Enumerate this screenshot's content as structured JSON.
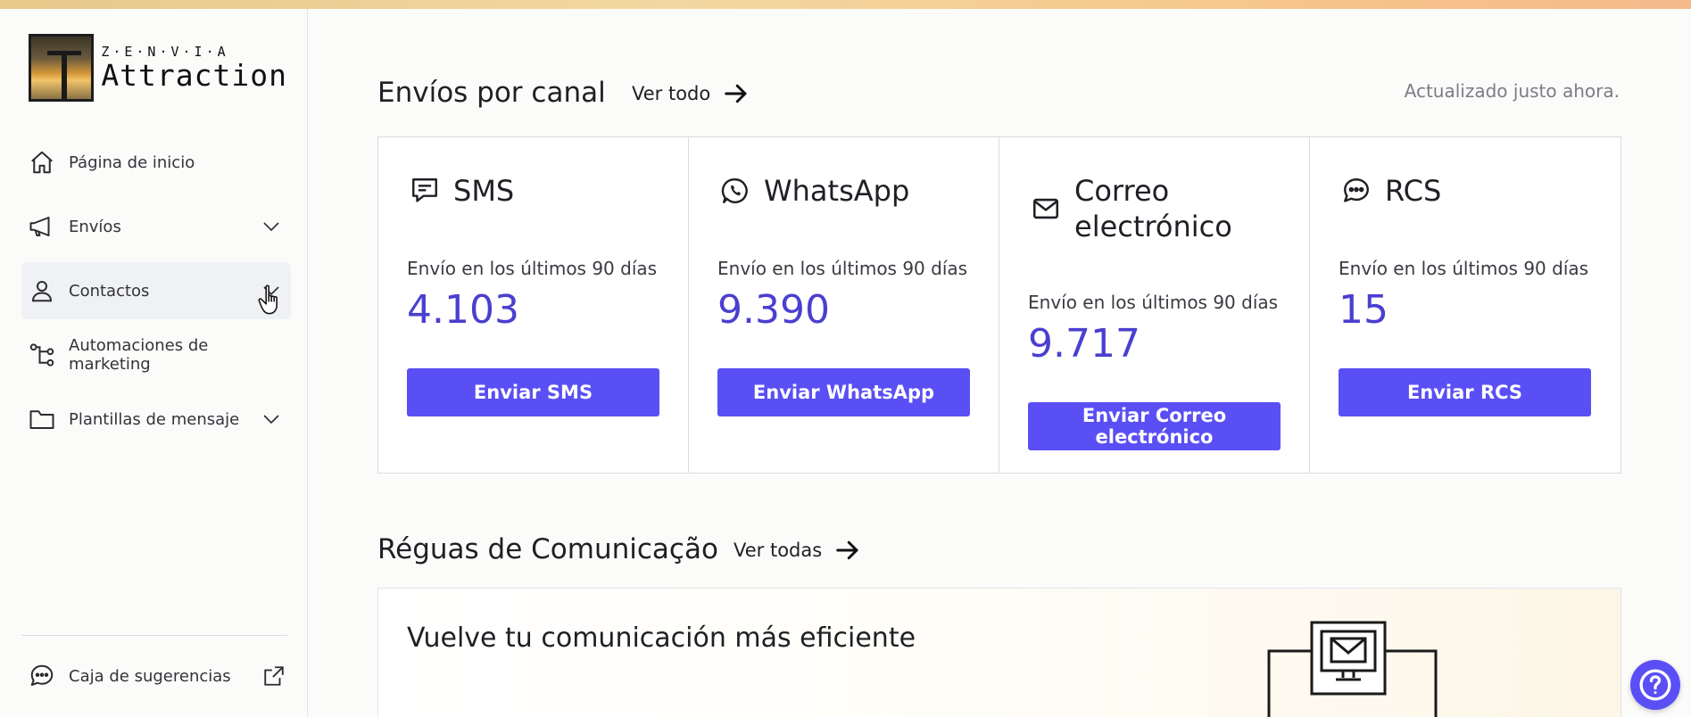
{
  "brand": {
    "company": "Z·E·N·V·I·A",
    "product": "Attraction"
  },
  "sidebar": {
    "items": [
      {
        "label": "Página de inicio",
        "icon": "home-icon"
      },
      {
        "label": "Envíos",
        "icon": "megaphone-icon",
        "expandable": true
      },
      {
        "label": "Contactos",
        "icon": "user-icon",
        "expandable": true,
        "active": true
      },
      {
        "label": "Automaciones de marketing",
        "icon": "flow-icon"
      },
      {
        "label": "Plantillas de mensaje",
        "icon": "folder-icon",
        "expandable": true
      }
    ],
    "feedback": {
      "label": "Caja de sugerencias",
      "icon": "chat-icon"
    }
  },
  "channels": {
    "title": "Envíos por canal",
    "see_all": "Ver todo",
    "updated": "Actualizado justo ahora.",
    "cards": [
      {
        "title": "SMS",
        "subtitle": "Envío en los últimos 90 días",
        "value": "4.103",
        "button": "Enviar SMS",
        "icon": "sms-icon"
      },
      {
        "title": "WhatsApp",
        "subtitle": "Envío en los últimos 90 días",
        "value": "9.390",
        "button": "Enviar WhatsApp",
        "icon": "whatsapp-icon"
      },
      {
        "title": "Correo electrónico",
        "subtitle": "Envío en los últimos 90 días",
        "value": "9.717",
        "button": "Enviar Correo electrónico",
        "icon": "mail-icon"
      },
      {
        "title": "RCS",
        "subtitle": "Envío en los últimos 90 días",
        "value": "15",
        "button": "Enviar RCS",
        "icon": "rcs-chat-icon"
      }
    ]
  },
  "reguas": {
    "title": "Réguas de Comunicação",
    "see_all": "Ver todas",
    "promo_title": "Vuelve tu comunicación más eficiente"
  },
  "colors": {
    "accent": "#5a4ff4",
    "value": "#4a3fcf"
  }
}
